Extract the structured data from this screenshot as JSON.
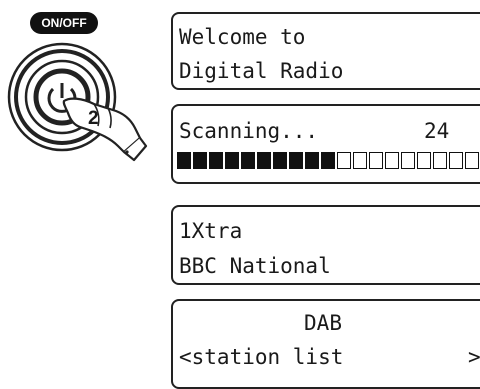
{
  "button": {
    "label": "ON/OFF",
    "press_count": "2"
  },
  "screens": [
    {
      "line1": "Welcome to",
      "line2": "Digital Radio"
    },
    {
      "line1": "Scanning...",
      "count": "24",
      "progress": {
        "filled": 10,
        "total": 20
      }
    },
    {
      "line1": "1Xtra",
      "line2": "BBC National"
    },
    {
      "line1": "DAB",
      "line2": "<station list",
      "arrow": ">"
    }
  ]
}
